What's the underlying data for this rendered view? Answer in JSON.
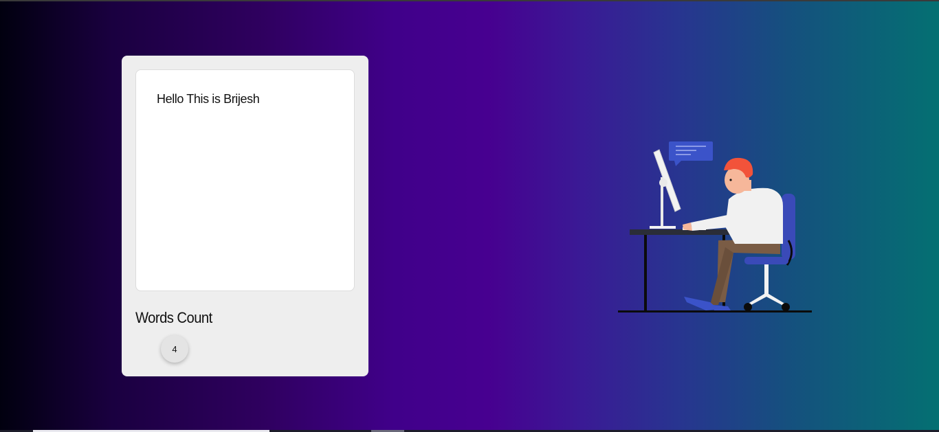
{
  "editor": {
    "text": "Hello This is Brijesh"
  },
  "word_count": {
    "title": "Words Count",
    "value": "4"
  },
  "illustration": {
    "name": "person-at-computer-illustration"
  },
  "colors": {
    "card_bg": "#eeeeee",
    "editor_bg": "#ffffff",
    "gradient_left": "#01000f",
    "gradient_mid": "#470090",
    "gradient_right": "#047072"
  }
}
